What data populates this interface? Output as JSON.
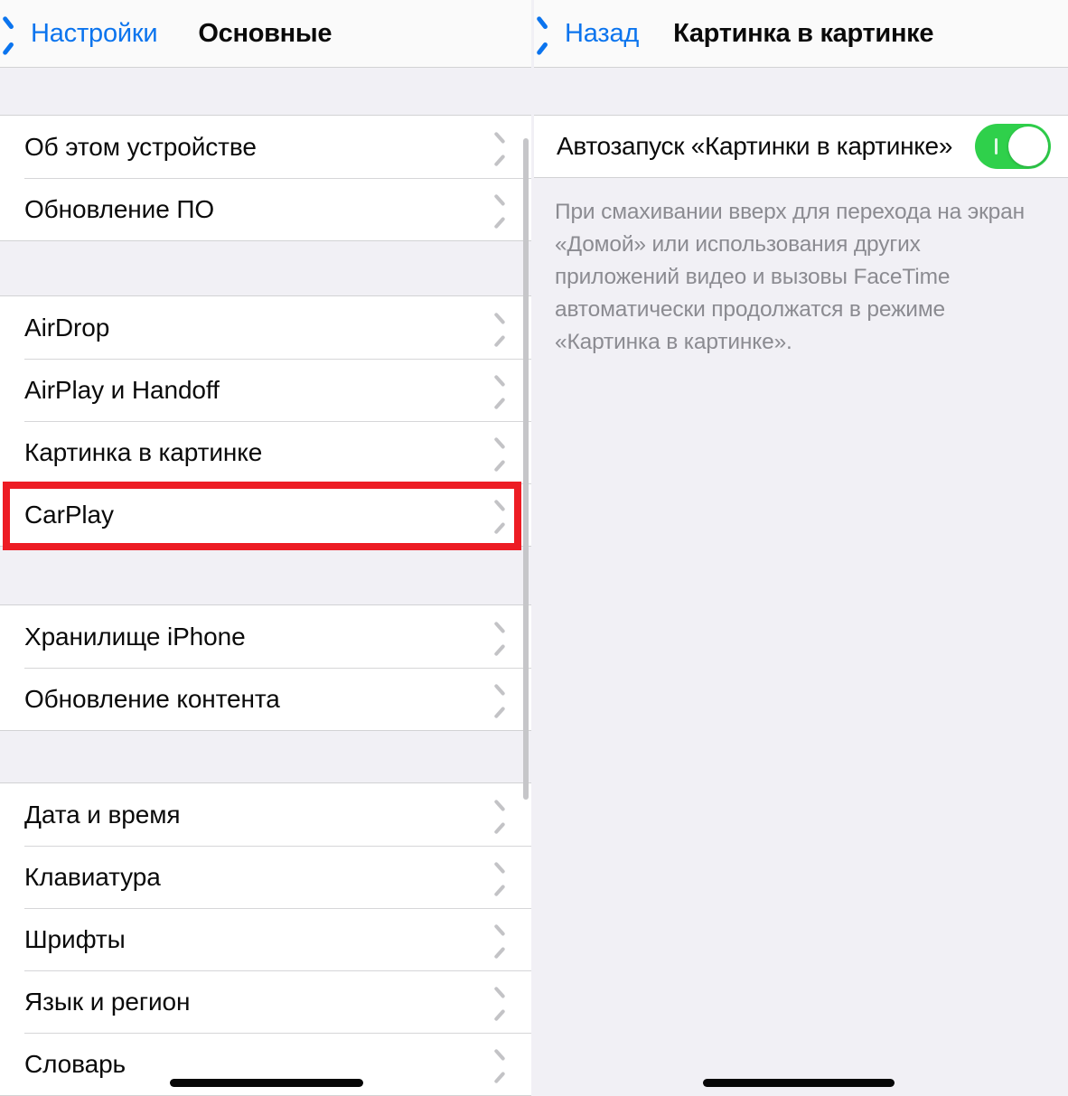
{
  "left_panel": {
    "nav": {
      "back_label": "Настройки",
      "back_icon": "chevron-left-icon",
      "title": "Основные"
    },
    "groups": [
      {
        "rows": [
          {
            "label": "Об этом устройстве",
            "accessory": "chevron-right-icon"
          },
          {
            "label": "Обновление ПО",
            "accessory": "chevron-right-icon"
          }
        ]
      },
      {
        "rows": [
          {
            "label": "AirDrop",
            "accessory": "chevron-right-icon"
          },
          {
            "label": "AirPlay и Handoff",
            "accessory": "chevron-right-icon"
          },
          {
            "label": "Картинка в картинке",
            "accessory": "chevron-right-icon",
            "highlighted": true
          },
          {
            "label": "CarPlay",
            "accessory": "chevron-right-icon"
          }
        ]
      },
      {
        "rows": [
          {
            "label": "Хранилище iPhone",
            "accessory": "chevron-right-icon"
          },
          {
            "label": "Обновление контента",
            "accessory": "chevron-right-icon"
          }
        ]
      },
      {
        "rows": [
          {
            "label": "Дата и время",
            "accessory": "chevron-right-icon"
          },
          {
            "label": "Клавиатура",
            "accessory": "chevron-right-icon"
          },
          {
            "label": "Шрифты",
            "accessory": "chevron-right-icon"
          },
          {
            "label": "Язык и регион",
            "accessory": "chevron-right-icon"
          },
          {
            "label": "Словарь",
            "accessory": "chevron-right-icon"
          }
        ]
      }
    ]
  },
  "right_panel": {
    "nav": {
      "back_label": "Назад",
      "back_icon": "chevron-left-icon",
      "title": "Картинка в картинке"
    },
    "setting": {
      "label": "Автозапуск «Картинки в картинке»",
      "switch_state": "on"
    },
    "description": "При смахивании вверх для перехода на экран «Домой» или использования других приложений видео и вызовы FaceTime автоматически продолжатся в режиме «Картинка в картинке»."
  },
  "colors": {
    "accent_blue": "#0B74EE",
    "switch_on_green": "#2FD04B",
    "highlight_red": "#ED1C24",
    "background_gray": "#F1F0F5",
    "row_white": "#FFFFFF",
    "chevron_gray": "#C3C3C6",
    "footer_text_gray": "#8B8B91"
  }
}
